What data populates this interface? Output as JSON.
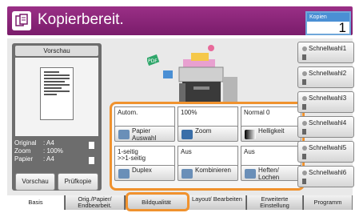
{
  "header": {
    "title": "Kopierbereit.",
    "app_icon": "copy-app-icon"
  },
  "copies": {
    "label": "Kopien",
    "value": "1"
  },
  "preview": {
    "header": "Vorschau",
    "info": [
      {
        "key": "Original",
        "value": ": A4"
      },
      {
        "key": "Zoom",
        "value": ": 100%"
      },
      {
        "key": "Papier",
        "value": ": A4"
      }
    ],
    "preview_button": "Vorschau",
    "proof_button": "Prüfkopie"
  },
  "functions": [
    {
      "value": "Autom.",
      "value2": "",
      "label": "Papier Auswahl",
      "icon": "paper-select-icon"
    },
    {
      "value": "100%",
      "value2": "",
      "label": "Zoom",
      "icon": "zoom-icon"
    },
    {
      "value": "Normal 0",
      "value2": "",
      "label": "Helligkeit",
      "icon": "density-icon"
    },
    {
      "value": "1-seitig",
      "value2": ">>1-seitig",
      "label": "Duplex",
      "icon": "duplex-icon"
    },
    {
      "value": "Aus",
      "value2": "",
      "label": "Kombinieren",
      "icon": "combine-icon"
    },
    {
      "value": "Aus",
      "value2": "",
      "label": "Heften/ Lochen",
      "icon": "staple-icon"
    }
  ],
  "quick_buttons": [
    "Schnellwahl1",
    "Schnellwahl2",
    "Schnellwahl3",
    "Schnellwahl4",
    "Schnellwahl5",
    "Schnellwahl6"
  ],
  "tabs": [
    {
      "label": "Basis",
      "active": true
    },
    {
      "label": "Orig./Papier/ Endbearbeit.",
      "active": false
    },
    {
      "label": "Bildqualität",
      "active": false
    },
    {
      "label": "Layout/ Bearbeiten",
      "active": false
    },
    {
      "label": "Erweiterte Einstellung",
      "active": false
    },
    {
      "label": "Programm",
      "active": false
    }
  ],
  "colors": {
    "header": "#8a2378",
    "accent": "#f0922e",
    "copies_border": "#4a8fd4"
  }
}
